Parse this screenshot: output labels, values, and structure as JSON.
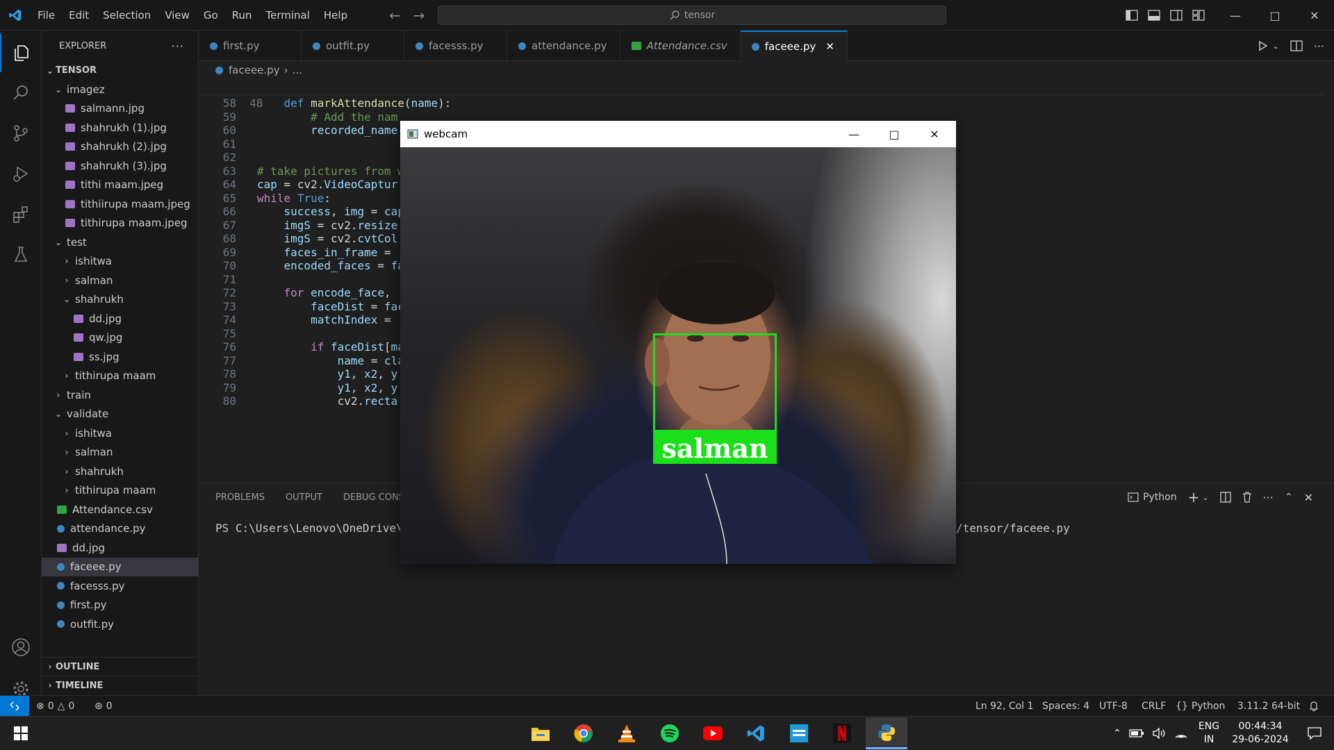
{
  "titlebar": {
    "menu": [
      "File",
      "Edit",
      "Selection",
      "View",
      "Go",
      "Run",
      "Terminal",
      "Help"
    ],
    "search_text": "tensor"
  },
  "sidebar": {
    "header": "EXPLORER",
    "root": "TENSOR",
    "items": [
      {
        "label": "imagez",
        "kind": "folder-open",
        "indent": 1
      },
      {
        "label": "salmann.jpg",
        "kind": "img",
        "indent": 2
      },
      {
        "label": "shahrukh (1).jpg",
        "kind": "img",
        "indent": 2
      },
      {
        "label": "shahrukh (2).jpg",
        "kind": "img",
        "indent": 2
      },
      {
        "label": "shahrukh (3).jpg",
        "kind": "img",
        "indent": 2
      },
      {
        "label": "tithi maam.jpeg",
        "kind": "img",
        "indent": 2
      },
      {
        "label": "tithiirupa maam.jpeg",
        "kind": "img",
        "indent": 2
      },
      {
        "label": "tithirupa maam.jpeg",
        "kind": "img",
        "indent": 2
      },
      {
        "label": "test",
        "kind": "folder-open",
        "indent": 1
      },
      {
        "label": "ishitwa",
        "kind": "folder",
        "indent": 2
      },
      {
        "label": "salman",
        "kind": "folder",
        "indent": 2
      },
      {
        "label": "shahrukh",
        "kind": "folder-open",
        "indent": 2
      },
      {
        "label": "dd.jpg",
        "kind": "img",
        "indent": 3
      },
      {
        "label": "qw.jpg",
        "kind": "img",
        "indent": 3
      },
      {
        "label": "ss.jpg",
        "kind": "img",
        "indent": 3
      },
      {
        "label": "tithirupa maam",
        "kind": "folder",
        "indent": 2
      },
      {
        "label": "train",
        "kind": "folder",
        "indent": 1
      },
      {
        "label": "validate",
        "kind": "folder-open",
        "indent": 1
      },
      {
        "label": "ishitwa",
        "kind": "folder",
        "indent": 2
      },
      {
        "label": "salman",
        "kind": "folder",
        "indent": 2
      },
      {
        "label": "shahrukh",
        "kind": "folder",
        "indent": 2
      },
      {
        "label": "tithirupa maam",
        "kind": "folder",
        "indent": 2
      },
      {
        "label": "Attendance.csv",
        "kind": "csv",
        "indent": 1
      },
      {
        "label": "attendance.py",
        "kind": "py",
        "indent": 1
      },
      {
        "label": "dd.jpg",
        "kind": "img",
        "indent": 1
      },
      {
        "label": "faceee.py",
        "kind": "py",
        "indent": 1,
        "selected": true
      },
      {
        "label": "facesss.py",
        "kind": "py",
        "indent": 1
      },
      {
        "label": "first.py",
        "kind": "py",
        "indent": 1
      },
      {
        "label": "outfit.py",
        "kind": "py",
        "indent": 1
      }
    ],
    "outline": "OUTLINE",
    "timeline": "TIMELINE"
  },
  "tabs": [
    {
      "label": "first.py",
      "kind": "py"
    },
    {
      "label": "outfit.py",
      "kind": "py"
    },
    {
      "label": "facesss.py",
      "kind": "py"
    },
    {
      "label": "attendance.py",
      "kind": "py"
    },
    {
      "label": "Attendance.csv",
      "kind": "csv"
    },
    {
      "label": "faceee.py",
      "kind": "py",
      "active": true
    }
  ],
  "breadcrumb": {
    "file": "faceee.py",
    "rest": "..."
  },
  "code": {
    "sticky": {
      "num": "48",
      "text": "def markAttendance(name):"
    },
    "lines": [
      {
        "num": "58",
        "text": ""
      },
      {
        "num": "59",
        "text": "        # Add the nam"
      },
      {
        "num": "60",
        "text": "        recorded_name"
      },
      {
        "num": "61",
        "text": ""
      },
      {
        "num": "62",
        "text": ""
      },
      {
        "num": "63",
        "text": "# take pictures from w"
      },
      {
        "num": "64",
        "text": "cap = cv2.VideoCaptur"
      },
      {
        "num": "65",
        "text": "while True:"
      },
      {
        "num": "66",
        "text": "    success, img = cap"
      },
      {
        "num": "67",
        "text": "    imgS = cv2.resize"
      },
      {
        "num": "68",
        "text": "    imgS = cv2.cvtCol"
      },
      {
        "num": "69",
        "text": "    faces_in_frame = "
      },
      {
        "num": "70",
        "text": "    encoded_faces = fa"
      },
      {
        "num": "71",
        "text": ""
      },
      {
        "num": "72",
        "text": "    for encode_face, "
      },
      {
        "num": "73",
        "text": "        faceDist = fac"
      },
      {
        "num": "74",
        "text": "        matchIndex = "
      },
      {
        "num": "75",
        "text": ""
      },
      {
        "num": "76",
        "text": "        if faceDist[ma"
      },
      {
        "num": "77",
        "text": "            name = cla"
      },
      {
        "num": "78",
        "text": "            y1, x2, y"
      },
      {
        "num": "79",
        "text": "            y1, x2, y"
      },
      {
        "num": "80",
        "text": "            cv2.recta"
      }
    ]
  },
  "panel": {
    "tabs": [
      "PROBLEMS",
      "OUTPUT",
      "DEBUG CONSO"
    ],
    "terminal_profile": "Python",
    "terminal_prefix": "PS C:\\Users\\Lenovo\\OneDrive\\De",
    "terminal_suffix": "/tensor/faceee.py"
  },
  "webcam": {
    "title": "webcam",
    "detected_name": "salman",
    "box_color": "#1be01b"
  },
  "statusbar": {
    "errors": "0",
    "warnings": "0",
    "ports": "0",
    "position": "Ln 92, Col 1",
    "spaces": "Spaces: 4",
    "encoding": "UTF-8",
    "eol": "CRLF",
    "language": "Python",
    "interpreter": "3.11.2 64-bit"
  },
  "taskbar": {
    "apps": [
      "file-explorer",
      "chrome",
      "vlc",
      "spotify",
      "youtube",
      "vscode",
      "prime-video",
      "netflix",
      "python"
    ],
    "lang_top": "ENG",
    "lang_bottom": "IN",
    "time": "00:44:34",
    "date": "29-06-2024"
  },
  "colors": {
    "accent": "#0078d4",
    "editor_bg": "#1f1f1f",
    "chrome_bg": "#181818"
  }
}
